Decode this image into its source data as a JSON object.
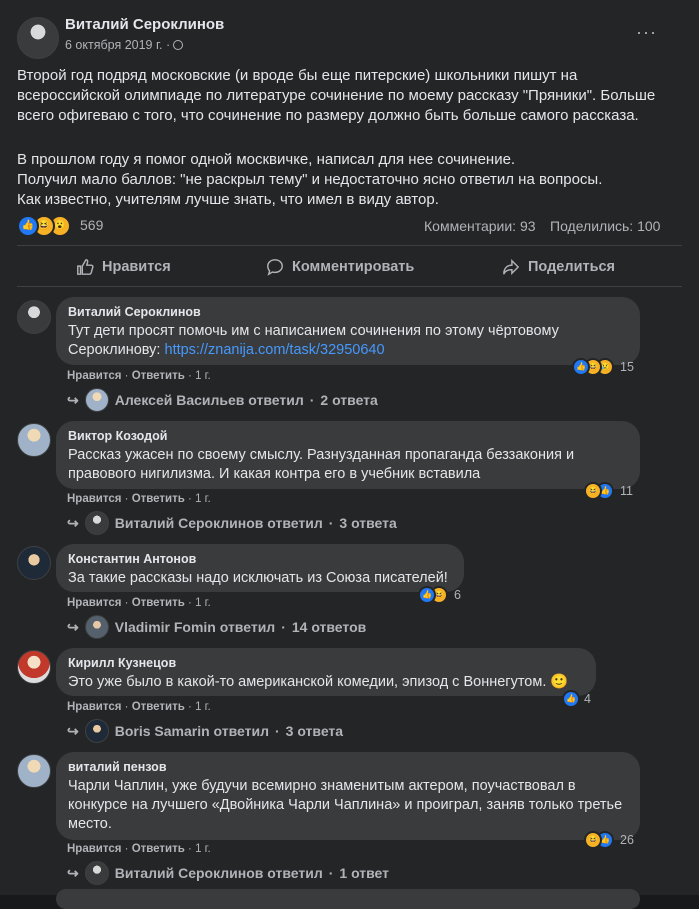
{
  "post": {
    "author": "Виталий Сероклинов",
    "date": "6 октября 2019 г. ·",
    "menu_label": "···",
    "paragraph1": "Второй год подряд московские (и вроде бы еще питерские) школьники пишут на всероссийской олимпиаде по литературе сочинение по моему рассказу \"Пряники\". Больше всего офигеваю с того, что сочинение по размеру должно быть больше самого рассказа.",
    "paragraph2_line1": "В прошлом году я помог одной москвичке, написал для нее сочинение.",
    "paragraph2_line2": "Получил мало баллов: \"не раскрыл тему\" и недостаточно ясно ответил на вопросы.",
    "paragraph2_line3": "Как известно, учителям лучше знать, что имел в виду автор.",
    "reactions_count": "569",
    "comments_count": "Комментарии: 93",
    "shares_count": "Поделились: 100"
  },
  "actions": {
    "like": "Нравится",
    "comment": "Комментировать",
    "share": "Поделиться"
  },
  "meta_labels": {
    "like": "Нравится",
    "reply": "Ответить",
    "sep": " · ",
    "time": "1 г."
  },
  "comments": [
    {
      "author": "Виталий Сероклинов",
      "text_before_link": "Тут дети просят помочь им с написанием сочинения по этому чёртовому Сероклинову: ",
      "link": "https://znanija.com/task/32950640",
      "reactions": "15",
      "reply_author": "Алексей Васильев ответил",
      "reply_count": "2 ответа"
    },
    {
      "author": "Виктор Козодой",
      "text": "Рассказ ужасен по своему смыслу. Разнузданная пропаганда беззакония и правового нигилизма. И какая контра его в учебник вставила",
      "reactions": "11",
      "reply_author": "Виталий Сероклинов ответил",
      "reply_count": "3 ответа"
    },
    {
      "author": "Константин Антонов",
      "text": "За такие рассказы надо исключать из Союза писателей!",
      "reactions": "6",
      "reply_author": "Vladimir Fomin ответил",
      "reply_count": "14 ответов"
    },
    {
      "author": "Кирилл Кузнецов",
      "text": "Это уже было в какой-то американской комедии, эпизод с Воннегутом. 🙂",
      "reactions": "4",
      "reply_author": "Boris Samarin ответил",
      "reply_count": "3 ответа"
    },
    {
      "author": "виталий пензов",
      "text": "Чарли Чаплин, уже будучи всемирно знаменитым актером, поучаствовал в конкурсе на лучшего «Двойника Чарли Чаплина» и проиграл, заняв только третье место.",
      "reactions": "26",
      "reply_author": "Виталий Сероклинов ответил",
      "reply_count": "1 ответ"
    }
  ],
  "colors": {
    "background": "#242526",
    "bubble": "#3a3b3c",
    "link": "#4599ff",
    "like": "#2078f4",
    "haha": "#f7b125"
  }
}
